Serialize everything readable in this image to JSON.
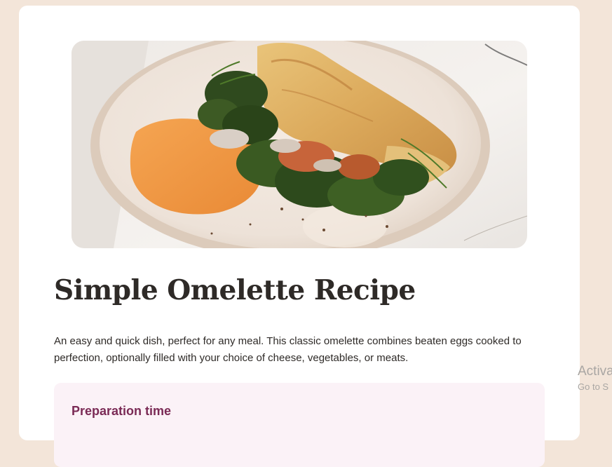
{
  "recipe": {
    "title": "Simple Omelette Recipe",
    "intro": "An easy and quick dish, perfect for any meal. This classic omelette combines beaten eggs cooked to perfection, optionally filled with your choice of cheese, vegetables, or meats."
  },
  "preparation": {
    "heading": "Preparation time"
  },
  "watermark": {
    "line1": "Activa",
    "line2": "Go to S"
  },
  "colors": {
    "page_background": "#f3e5d9",
    "card_background": "#ffffff",
    "heading_text": "#2e2a27",
    "body_text": "#2e2a27",
    "preparation_background": "#fbf2f7",
    "preparation_heading": "#7a2a55"
  }
}
